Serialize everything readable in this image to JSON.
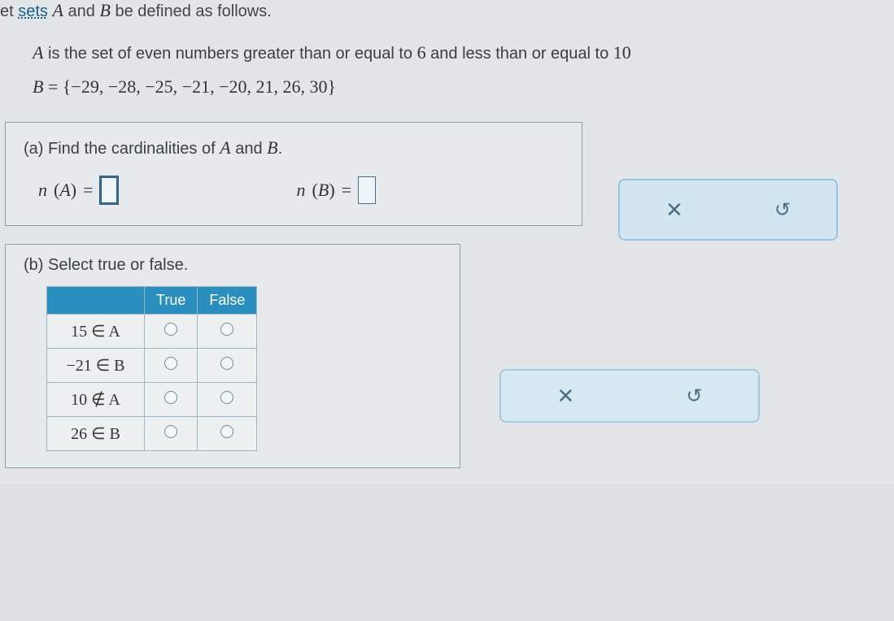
{
  "intro": {
    "prefix": "et ",
    "link_word": "sets",
    "mid": " ",
    "A": "A",
    "and": " and ",
    "B": "B",
    "suffix": " be defined as follows."
  },
  "defs": {
    "line1_pre": "A",
    "line1_text": " is the set of even numbers greater than or equal to ",
    "six": "6",
    "line1_mid": " and less than or equal to ",
    "ten": "10",
    "line2_pre": "B",
    "line2_eq": " = ",
    "line2_set": "{−29, −28, −25, −21, −20, 21, 26, 30}"
  },
  "partA": {
    "label": "(a) Find the cardinalities of ",
    "A": "A",
    "and": " and ",
    "B": "B",
    "period": ".",
    "nA_pre": "n",
    "nA_paren_open": "(",
    "nA_var": "A",
    "nA_paren_close": ")",
    "eq": " = ",
    "nB_pre": "n",
    "nB_paren_open": "(",
    "nB_var": "B",
    "nB_paren_close": ")"
  },
  "partB": {
    "label": "(b) Select true or false.",
    "headers": {
      "true": "True",
      "false": "False"
    },
    "rows": [
      {
        "expr": "15 ∈ A"
      },
      {
        "expr": "−21 ∈ B"
      },
      {
        "expr": "10 ∉ A"
      },
      {
        "expr": "26 ∈ B"
      }
    ]
  },
  "icons": {
    "close": "✕",
    "reset": "↺"
  }
}
